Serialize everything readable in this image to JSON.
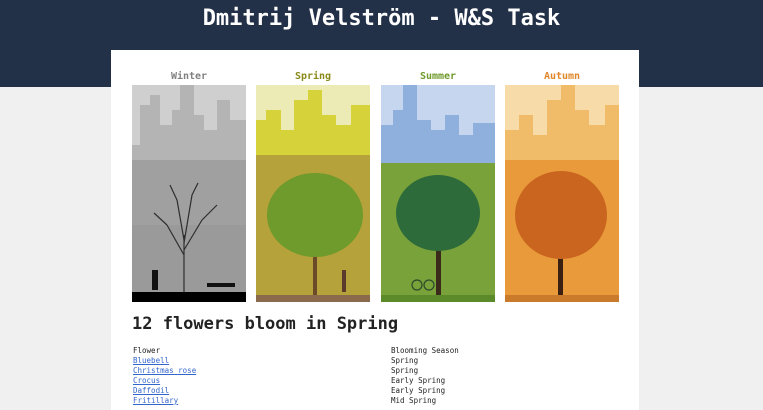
{
  "header": {
    "title": "Dmitrij Velström - W&S Task"
  },
  "seasons": [
    {
      "label": "Winter",
      "color": "#808080",
      "sky": "#cfcfcf",
      "ground": "#9a9a9a",
      "tree": "#2e2e2e"
    },
    {
      "label": "Spring",
      "color": "#8a8a1a",
      "sky": "#ecebb5",
      "ground": "#b5a23a",
      "tree": "#6f9a2c"
    },
    {
      "label": "Summer",
      "color": "#6f9a2c",
      "sky": "#c5d6ee",
      "ground": "#7aa23a",
      "tree": "#2e6b3a"
    },
    {
      "label": "Autumn",
      "color": "#e0872a",
      "sky": "#f7dcaa",
      "ground": "#e99a3a",
      "tree": "#c9651f"
    }
  ],
  "main": {
    "heading": "12 flowers bloom in Spring",
    "columns": {
      "flower": "Flower",
      "season": "Blooming Season"
    },
    "rows": [
      {
        "flower": "Bluebell",
        "season": "Spring"
      },
      {
        "flower": "Christmas rose",
        "season": "Spring"
      },
      {
        "flower": "Crocus",
        "season": "Early Spring"
      },
      {
        "flower": "Daffodil",
        "season": "Early Spring"
      },
      {
        "flower": "Fritillary",
        "season": "Mid Spring"
      }
    ]
  }
}
